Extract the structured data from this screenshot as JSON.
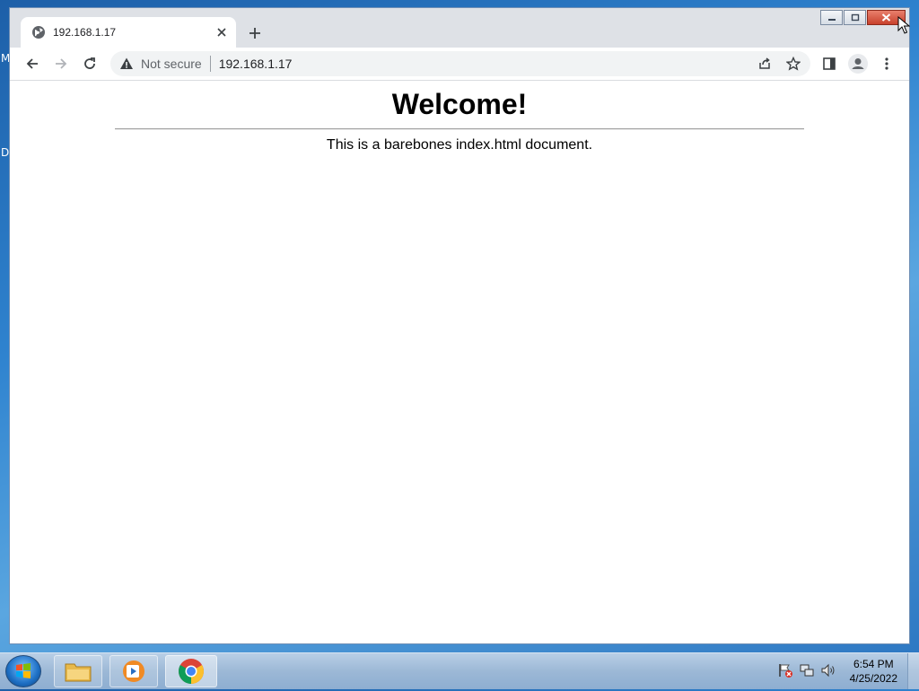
{
  "window": {
    "tab": {
      "title": "192.168.1.17"
    },
    "toolbar": {
      "security_label": "Not secure",
      "url": "192.168.1.17"
    }
  },
  "page": {
    "heading": "Welcome!",
    "paragraph": "This is a barebones index.html document."
  },
  "desktop": {
    "frag_top": "M",
    "frag_mid": "D"
  },
  "taskbar": {
    "time": "6:54 PM",
    "date": "4/25/2022"
  },
  "colors": {
    "accent": "#1a73e8",
    "close_button": "#c8412c"
  }
}
